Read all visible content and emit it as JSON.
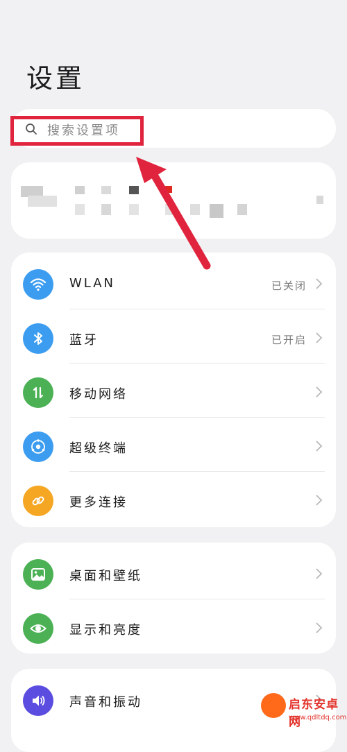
{
  "header": {
    "title": "设置"
  },
  "search": {
    "placeholder": "搜索设置项",
    "icon": "search-icon"
  },
  "colors": {
    "page_background": "#f1f1f3",
    "card_background": "#ffffff",
    "highlight_red": "#e1243e",
    "arrow_red": "#e1243e",
    "wlan_icon": "#3c9df0",
    "bluetooth_icon": "#3c9df0",
    "mobile_network_icon": "#4bb154",
    "super_device_icon": "#3c9df0",
    "more_connections_icon": "#f5a623",
    "wallpaper_icon": "#4bb154",
    "display_icon": "#4bb154",
    "sound_icon": "#5b4de0"
  },
  "groups": [
    {
      "items": [
        {
          "label": "WLAN",
          "value": "已关闭",
          "icon": "wifi-icon"
        },
        {
          "label": "蓝牙",
          "value": "已开启",
          "icon": "bluetooth-icon"
        },
        {
          "label": "移动网络",
          "value": "",
          "icon": "mobile-data-icon"
        },
        {
          "label": "超级终端",
          "value": "",
          "icon": "super-device-icon"
        },
        {
          "label": "更多连接",
          "value": "",
          "icon": "link-icon"
        }
      ]
    },
    {
      "items": [
        {
          "label": "桌面和壁纸",
          "value": "",
          "icon": "image-icon"
        },
        {
          "label": "显示和亮度",
          "value": "",
          "icon": "eye-icon"
        }
      ]
    },
    {
      "items": [
        {
          "label": "声音和振动",
          "value": "",
          "icon": "speaker-icon"
        }
      ]
    }
  ],
  "watermark": {
    "name": "启东安卓网",
    "url": "www.qdltdq.com"
  }
}
